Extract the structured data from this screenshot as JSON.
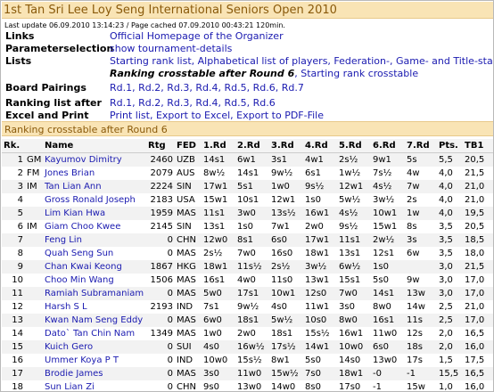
{
  "title": "1st Tan Sri Lee Loy Seng International Seniors Open 2010",
  "last_update": "Last update 06.09.2010 13:14:23 / Page cached 07.09.2010 00:43:21 120min.",
  "links": {
    "label": "Links",
    "value": "Official Homepage of the Organizer"
  },
  "params": {
    "label": "Parameterselection",
    "value": "show tournament-details"
  },
  "lists": {
    "label": "Lists",
    "line1": "Starting rank list, Alphabetical list of players, Federation-, Game- and Title-statistics",
    "line2_bold": "Ranking crosstable after Round 6",
    "line2_rest": ", Starting rank crosstable"
  },
  "pairings": {
    "label": "Board Pairings",
    "links": [
      "Rd.1",
      "Rd.2",
      "Rd.3",
      "Rd.4",
      "Rd.5",
      "Rd.6",
      "Rd.7"
    ]
  },
  "ranking_after": {
    "label": "Ranking list after",
    "links": [
      "Rd.1",
      "Rd.2",
      "Rd.3",
      "Rd.4",
      "Rd.5",
      "Rd.6"
    ]
  },
  "excel": {
    "label": "Excel and Print",
    "links": [
      "Print list",
      "Export to Excel",
      "Export to PDF-File"
    ]
  },
  "section_title": "Ranking crosstable after Round 6",
  "columns": [
    "Rk.",
    "",
    "Name",
    "Rtg",
    "FED",
    "1.Rd",
    "2.Rd",
    "3.Rd",
    "4.Rd",
    "5.Rd",
    "6.Rd",
    "7.Rd",
    "Pts.",
    "TB1"
  ],
  "rows": [
    [
      "1",
      "GM",
      "Kayumov Dimitry",
      "2460",
      "UZB",
      "14s1",
      "6w1",
      "3s1",
      "4w1",
      "2s½",
      "9w1",
      "5s",
      "5,5",
      "20,5"
    ],
    [
      "2",
      "FM",
      "Jones Brian",
      "2079",
      "AUS",
      "8w½",
      "14s1",
      "9w½",
      "6s1",
      "1w½",
      "7s½",
      "4w",
      "4,0",
      "21,5"
    ],
    [
      "3",
      "IM",
      "Tan Lian Ann",
      "2224",
      "SIN",
      "17w1",
      "5s1",
      "1w0",
      "9s½",
      "12w1",
      "4s½",
      "7w",
      "4,0",
      "21,0"
    ],
    [
      "4",
      "",
      "Gross Ronald Joseph",
      "2183",
      "USA",
      "15w1",
      "10s1",
      "12w1",
      "1s0",
      "5w½",
      "3w½",
      "2s",
      "4,0",
      "21,0"
    ],
    [
      "5",
      "",
      "Lim Kian Hwa",
      "1959",
      "MAS",
      "11s1",
      "3w0",
      "13s½",
      "16w1",
      "4s½",
      "10w1",
      "1w",
      "4,0",
      "19,5"
    ],
    [
      "6",
      "IM",
      "Giam Choo Kwee",
      "2145",
      "SIN",
      "13s1",
      "1s0",
      "7w1",
      "2w0",
      "9s½",
      "15w1",
      "8s",
      "3,5",
      "20,5"
    ],
    [
      "7",
      "",
      "Feng Lin",
      "0",
      "CHN",
      "12w0",
      "8s1",
      "6s0",
      "17w1",
      "11s1",
      "2w½",
      "3s",
      "3,5",
      "18,5"
    ],
    [
      "8",
      "",
      "Quah Seng Sun",
      "0",
      "MAS",
      "2s½",
      "7w0",
      "16s0",
      "18w1",
      "13s1",
      "12s1",
      "6w",
      "3,5",
      "18,0"
    ],
    [
      "9",
      "",
      "Chan Kwai Keong",
      "1867",
      "HKG",
      "18w1",
      "11s½",
      "2s½",
      "3w½",
      "6w½",
      "1s0",
      "",
      "3,0",
      "21,5"
    ],
    [
      "10",
      "",
      "Choo Min Wang",
      "1506",
      "MAS",
      "16s1",
      "4w0",
      "11s0",
      "13w1",
      "15s1",
      "5s0",
      "9w",
      "3,0",
      "17,0"
    ],
    [
      "11",
      "",
      "Ramiah Subramaniam",
      "0",
      "MAS",
      "5w0",
      "17s1",
      "10w1",
      "12s0",
      "7w0",
      "14s1",
      "13w",
      "3,0",
      "17,0"
    ],
    [
      "12",
      "",
      "Harsh S L",
      "2193",
      "IND",
      "7s1",
      "9w½",
      "4s0",
      "11w1",
      "3s0",
      "8w0",
      "14w",
      "2,5",
      "21,0"
    ],
    [
      "13",
      "",
      "Kwan Nam Seng Eddy",
      "0",
      "MAS",
      "6w0",
      "18s1",
      "5w½",
      "10s0",
      "8w0",
      "16s1",
      "11s",
      "2,5",
      "17,0"
    ],
    [
      "14",
      "",
      "Dato` Tan Chin Nam",
      "1349",
      "MAS",
      "1w0",
      "2w0",
      "18s1",
      "15s½",
      "16w1",
      "11w0",
      "12s",
      "2,0",
      "16,5"
    ],
    [
      "15",
      "",
      "Kuich Gero",
      "0",
      "SUI",
      "4s0",
      "16w½",
      "17s½",
      "14w1",
      "10w0",
      "6s0",
      "18s",
      "2,0",
      "16,0"
    ],
    [
      "16",
      "",
      "Ummer Koya P T",
      "0",
      "IND",
      "10w0",
      "15s½",
      "8w1",
      "5s0",
      "14s0",
      "13w0",
      "17s",
      "1,5",
      "17,5"
    ],
    [
      "17",
      "",
      "Brodie James",
      "0",
      "MAS",
      "3s0",
      "11w0",
      "15w½",
      "7s0",
      "18w1",
      "-0",
      "-1",
      "15,5",
      "16,5"
    ],
    [
      "18",
      "",
      "Sun Lian Zi",
      "0",
      "CHN",
      "9s0",
      "13w0",
      "14w0",
      "8s0",
      "17s0",
      "-1",
      "15w",
      "1,0",
      "16,0"
    ]
  ],
  "colors": {
    "header_bg": "#f9e4b5",
    "header_text": "#8a5a0b",
    "link": "#1a1ab0"
  }
}
